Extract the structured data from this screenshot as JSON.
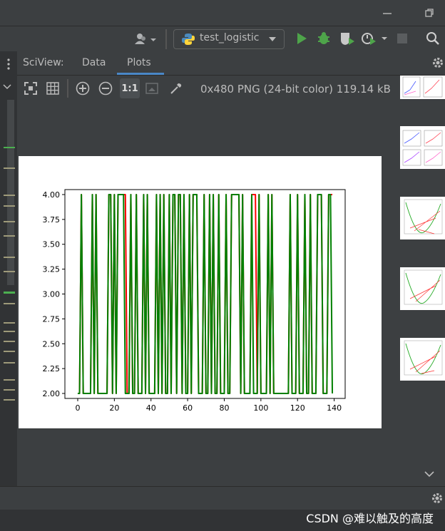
{
  "run_config": {
    "label": "test_logistic"
  },
  "sciview": {
    "label": "SciView:",
    "tabs": [
      {
        "label": "Data"
      },
      {
        "label": "Plots"
      }
    ],
    "active_tab": "Plots"
  },
  "plot_toolbar": {
    "actual_size_label": "1:1",
    "image_info": "0x480 PNG (24-bit color) 119.14 kB"
  },
  "watermark": "CSDN @难以触及的高度",
  "colors": {
    "series_red": "#ff0000",
    "series_green": "#008000",
    "accent": "#4a88c7"
  },
  "chart_data": {
    "type": "line",
    "xlim": [
      -7,
      146
    ],
    "ylim": [
      1.95,
      4.05
    ],
    "xticks": [
      0,
      20,
      40,
      60,
      80,
      100,
      120,
      140
    ],
    "yticks": [
      2.0,
      2.25,
      2.5,
      2.75,
      3.0,
      3.25,
      3.5,
      3.75,
      4.0
    ],
    "ytick_labels": [
      "2.00",
      "2.25",
      "2.50",
      "2.75",
      "3.00",
      "3.25",
      "3.50",
      "3.75",
      "4.00"
    ],
    "grid": false,
    "legend": false,
    "series": [
      {
        "color": "red",
        "values": [
          2,
          2,
          4,
          2,
          2,
          2,
          2,
          2,
          4,
          2,
          4,
          2,
          2,
          2,
          2,
          2,
          2,
          4,
          4,
          2,
          4,
          2,
          4,
          4,
          4,
          4,
          4,
          2,
          2,
          4,
          2,
          2,
          4,
          2,
          2,
          2,
          4,
          2,
          4,
          2,
          2,
          2,
          2,
          4,
          2,
          4,
          2,
          4,
          2,
          2,
          4,
          2,
          4,
          4,
          2,
          4,
          4,
          2,
          4,
          2,
          2,
          4,
          2,
          4,
          4,
          4,
          2,
          2,
          2,
          4,
          2,
          2,
          4,
          2,
          4,
          2,
          2,
          4,
          2,
          2,
          2,
          4,
          2,
          2,
          4,
          4,
          4,
          4,
          4,
          2,
          4,
          2,
          2,
          2,
          2,
          4,
          4,
          4,
          2,
          4,
          2,
          2,
          2,
          2,
          4,
          2,
          4,
          2,
          2,
          2,
          2,
          2,
          2,
          2,
          2,
          2,
          4,
          2,
          2,
          2,
          4,
          2,
          2,
          2,
          4,
          2,
          2,
          4,
          2,
          2,
          2,
          4,
          4,
          4,
          2,
          2,
          2,
          4,
          4,
          4
        ]
      },
      {
        "color": "green",
        "values": [
          2,
          2,
          4,
          2,
          2,
          2,
          2,
          2,
          4,
          2,
          4,
          2,
          2,
          2,
          2,
          2,
          2,
          4,
          4,
          2,
          4,
          2,
          4,
          4,
          4,
          4,
          2,
          2,
          2,
          4,
          2,
          2,
          4,
          2,
          2,
          2,
          4,
          2,
          4,
          2,
          2,
          2,
          2,
          4,
          2,
          4,
          2,
          4,
          2,
          2,
          4,
          2,
          4,
          4,
          2,
          4,
          4,
          2,
          4,
          2,
          2,
          4,
          2,
          4,
          4,
          4,
          2,
          2,
          2,
          4,
          2,
          2,
          4,
          2,
          4,
          2,
          2,
          4,
          2,
          2,
          2,
          4,
          2,
          2,
          4,
          4,
          4,
          4,
          4,
          2,
          4,
          2,
          2,
          2,
          2,
          4,
          2,
          2,
          2,
          4,
          2,
          2,
          2,
          2,
          4,
          2,
          4,
          2,
          2,
          2,
          2,
          2,
          2,
          2,
          2,
          2,
          4,
          2,
          2,
          2,
          4,
          2,
          2,
          2,
          4,
          2,
          2,
          4,
          2,
          2,
          2,
          4,
          4,
          4,
          2,
          2,
          2,
          4,
          4,
          2
        ]
      }
    ]
  }
}
